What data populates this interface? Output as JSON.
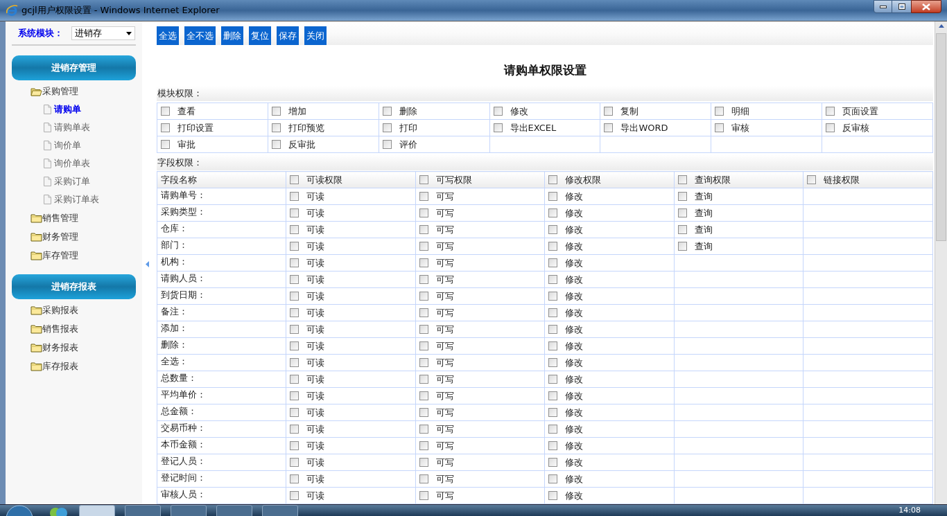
{
  "window": {
    "title": "gcjl用户权限设置 - Windows Internet Explorer"
  },
  "sidebar": {
    "module_label": "系统模块：",
    "module_select": "进销存",
    "sections": [
      {
        "title": "进销存管理",
        "items": [
          {
            "label": "采购管理",
            "expanded": true,
            "children": [
              {
                "label": "请购单",
                "selected": true
              },
              {
                "label": "请购单表",
                "selected": false
              },
              {
                "label": "询价单",
                "selected": false
              },
              {
                "label": "询价单表",
                "selected": false
              },
              {
                "label": "采购订单",
                "selected": false
              },
              {
                "label": "采购订单表",
                "selected": false
              }
            ]
          },
          {
            "label": "销售管理",
            "expanded": false
          },
          {
            "label": "财务管理",
            "expanded": false
          },
          {
            "label": "库存管理",
            "expanded": false
          }
        ]
      },
      {
        "title": "进销存报表",
        "items": [
          {
            "label": "采购报表",
            "expanded": false
          },
          {
            "label": "销售报表",
            "expanded": false
          },
          {
            "label": "财务报表",
            "expanded": false
          },
          {
            "label": "库存报表",
            "expanded": false
          }
        ]
      }
    ]
  },
  "toolbar": [
    "全选",
    "全不选",
    "删除",
    "复位",
    "保存",
    "关闭"
  ],
  "page_title": "请购单权限设置",
  "module_permissions": {
    "label": "模块权限：",
    "items": [
      {
        "label": "查看",
        "checked": false
      },
      {
        "label": "增加",
        "checked": false
      },
      {
        "label": "删除",
        "checked": false
      },
      {
        "label": "修改",
        "checked": false
      },
      {
        "label": "复制",
        "checked": false
      },
      {
        "label": "明细",
        "checked": false
      },
      {
        "label": "页面设置",
        "checked": false
      },
      {
        "label": "打印设置",
        "checked": false
      },
      {
        "label": "打印预览",
        "checked": false
      },
      {
        "label": "打印",
        "checked": false
      },
      {
        "label": "导出EXCEL",
        "checked": false
      },
      {
        "label": "导出WORD",
        "checked": false
      },
      {
        "label": "审核",
        "checked": false
      },
      {
        "label": "反审核",
        "checked": false
      },
      {
        "label": "审批",
        "checked": false
      },
      {
        "label": "反审批",
        "checked": false
      },
      {
        "label": "评价",
        "checked": false
      }
    ]
  },
  "field_permissions": {
    "label": "字段权限：",
    "name_header": "字段名称",
    "columns": [
      {
        "label": "可读权限",
        "checked": false
      },
      {
        "label": "可写权限",
        "checked": false
      },
      {
        "label": "修改权限",
        "checked": false
      },
      {
        "label": "查询权限",
        "checked": false
      },
      {
        "label": "链接权限",
        "checked": false
      }
    ],
    "rows": [
      {
        "name": "请购单号：",
        "cells": [
          {
            "label": "可读",
            "checked": false
          },
          {
            "label": "可写",
            "checked": false
          },
          {
            "label": "修改",
            "checked": false
          },
          {
            "label": "查询",
            "checked": false
          }
        ]
      },
      {
        "name": "采购类型：",
        "cells": [
          {
            "label": "可读",
            "checked": false
          },
          {
            "label": "可写",
            "checked": false
          },
          {
            "label": "修改",
            "checked": false
          },
          {
            "label": "查询",
            "checked": false
          }
        ]
      },
      {
        "name": "仓库：",
        "cells": [
          {
            "label": "可读",
            "checked": false
          },
          {
            "label": "可写",
            "checked": false
          },
          {
            "label": "修改",
            "checked": false
          },
          {
            "label": "查询",
            "checked": false
          }
        ]
      },
      {
        "name": "部门：",
        "cells": [
          {
            "label": "可读",
            "checked": false
          },
          {
            "label": "可写",
            "checked": false
          },
          {
            "label": "修改",
            "checked": false
          },
          {
            "label": "查询",
            "checked": false
          }
        ]
      },
      {
        "name": "机构：",
        "cells": [
          {
            "label": "可读",
            "checked": false
          },
          {
            "label": "可写",
            "checked": false
          },
          {
            "label": "修改",
            "checked": false
          }
        ]
      },
      {
        "name": "请购人员：",
        "cells": [
          {
            "label": "可读",
            "checked": false
          },
          {
            "label": "可写",
            "checked": false
          },
          {
            "label": "修改",
            "checked": false
          }
        ]
      },
      {
        "name": "到货日期：",
        "cells": [
          {
            "label": "可读",
            "checked": false
          },
          {
            "label": "可写",
            "checked": false
          },
          {
            "label": "修改",
            "checked": false
          }
        ]
      },
      {
        "name": "备注：",
        "cells": [
          {
            "label": "可读",
            "checked": false
          },
          {
            "label": "可写",
            "checked": false
          },
          {
            "label": "修改",
            "checked": false
          }
        ]
      },
      {
        "name": "添加：",
        "cells": [
          {
            "label": "可读",
            "checked": false
          },
          {
            "label": "可写",
            "checked": false
          },
          {
            "label": "修改",
            "checked": false
          }
        ]
      },
      {
        "name": "删除：",
        "cells": [
          {
            "label": "可读",
            "checked": false
          },
          {
            "label": "可写",
            "checked": false
          },
          {
            "label": "修改",
            "checked": false
          }
        ]
      },
      {
        "name": "全选：",
        "cells": [
          {
            "label": "可读",
            "checked": false
          },
          {
            "label": "可写",
            "checked": false
          },
          {
            "label": "修改",
            "checked": false
          }
        ]
      },
      {
        "name": "总数量：",
        "cells": [
          {
            "label": "可读",
            "checked": false
          },
          {
            "label": "可写",
            "checked": false
          },
          {
            "label": "修改",
            "checked": false
          }
        ]
      },
      {
        "name": "平均单价：",
        "cells": [
          {
            "label": "可读",
            "checked": false
          },
          {
            "label": "可写",
            "checked": false
          },
          {
            "label": "修改",
            "checked": false
          }
        ]
      },
      {
        "name": "总金额：",
        "cells": [
          {
            "label": "可读",
            "checked": false
          },
          {
            "label": "可写",
            "checked": false
          },
          {
            "label": "修改",
            "checked": false
          }
        ]
      },
      {
        "name": "交易币种：",
        "cells": [
          {
            "label": "可读",
            "checked": false
          },
          {
            "label": "可写",
            "checked": false
          },
          {
            "label": "修改",
            "checked": false
          }
        ]
      },
      {
        "name": "本币金额：",
        "cells": [
          {
            "label": "可读",
            "checked": false
          },
          {
            "label": "可写",
            "checked": false
          },
          {
            "label": "修改",
            "checked": false
          }
        ]
      },
      {
        "name": "登记人员：",
        "cells": [
          {
            "label": "可读",
            "checked": false
          },
          {
            "label": "可写",
            "checked": false
          },
          {
            "label": "修改",
            "checked": false
          }
        ]
      },
      {
        "name": "登记时间：",
        "cells": [
          {
            "label": "可读",
            "checked": false
          },
          {
            "label": "可写",
            "checked": false
          },
          {
            "label": "修改",
            "checked": false
          }
        ]
      },
      {
        "name": "审核人员：",
        "cells": [
          {
            "label": "可读",
            "checked": false
          },
          {
            "label": "可写",
            "checked": false
          },
          {
            "label": "修改",
            "checked": false
          }
        ]
      }
    ]
  },
  "taskbar": {
    "clock": "14:08"
  }
}
